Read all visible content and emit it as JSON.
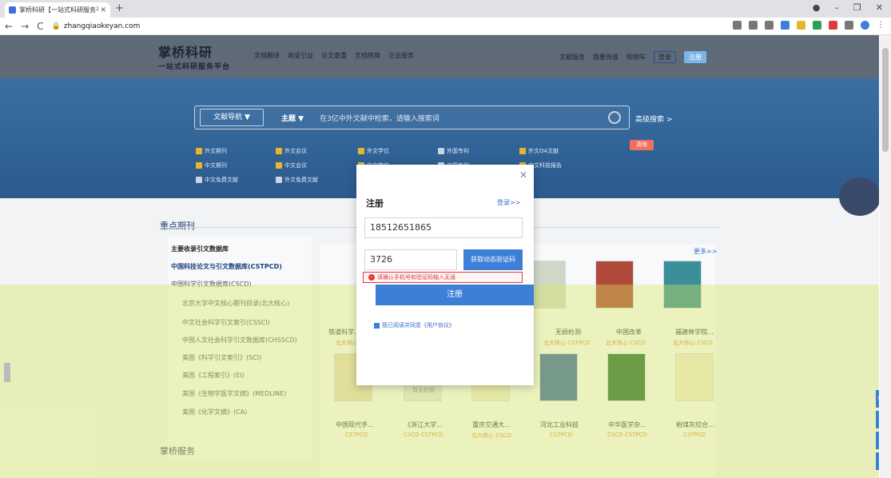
{
  "browser": {
    "tab_title": "掌桥科研【一站式科研服务平台】",
    "url": "zhangqiaokeyan.com"
  },
  "header": {
    "logo_main": "掌桥科研",
    "logo_sub": "一站式科研服务平台",
    "nav": [
      "文档翻译",
      "收录引证",
      "论文查重",
      "文档转换",
      "企业服务"
    ],
    "right_nav": [
      "文献服务",
      "我要充值",
      "购物车"
    ],
    "login": "登录",
    "register": "注册"
  },
  "search": {
    "db_nav": "文献导航 ▼",
    "subject": "主题 ▼",
    "placeholder": "在3亿中外文献中检索，请输入搜索词",
    "advanced": "高级搜索 >",
    "checkboxes": [
      "外文期刊",
      "外文会议",
      "外文学位",
      "外国专利",
      "外文OA文献",
      "中文期刊",
      "中文会议",
      "中文学位",
      "中国专利",
      "中文科技报告",
      "中文免费文献",
      "外文免费文献"
    ],
    "clear": "清除"
  },
  "section": {
    "title": "重点期刊",
    "more": "更多>>",
    "left_list": [
      "主要收录引文数据库",
      "中国科技论文与引文数据库(CSTPCD)",
      "中国科学引文数据库(CSCD)",
      "北京大学中文核心期刊目录(北大核心)",
      "中文社会科学引文索引(CSSCI)",
      "中国人文社会科学引文数据库(CHSSCD)",
      "美国《科学引文索引》(SCI)",
      "美国《工程索引》(EI)",
      "美国《生物学医学文摘》(MEDLINE)",
      "美国《化学文摘》(CA)"
    ],
    "magazines_row1": [
      {
        "name": "铁道科学...",
        "tag": "北大核心"
      },
      {
        "name": "无损检测",
        "tag": "北大核心 CSTPCD"
      },
      {
        "name": "中国改革",
        "tag": "北大核心 CSCD"
      },
      {
        "name": "福建林学院...",
        "tag": "北大核心 CSCD"
      }
    ],
    "magazines_row2": [
      {
        "name": "中国现代手...",
        "tag": "CSTPCD"
      },
      {
        "name": "《浙江大学...",
        "tag": "CSCD CSTPCD"
      },
      {
        "name": "重庆交通大...",
        "tag": "北大核心 CSCD"
      },
      {
        "name": "河北工业科技",
        "tag": "CSTPCD"
      },
      {
        "name": "中华医学杂...",
        "tag": "CSCD CSTPCD"
      },
      {
        "name": "粉煤灰综合...",
        "tag": "CSTPCD"
      }
    ],
    "no_cover": "暂无封面",
    "service_title": "掌桥服务"
  },
  "modal": {
    "title": "注册",
    "login_link": "登录>>",
    "phone": "18512651865",
    "code": "3726",
    "get_code": "获取动态验证码",
    "error": "请确认手机号和验证码输入无误",
    "submit": "注册",
    "agree": "我已阅读并同意《用户协议》"
  }
}
